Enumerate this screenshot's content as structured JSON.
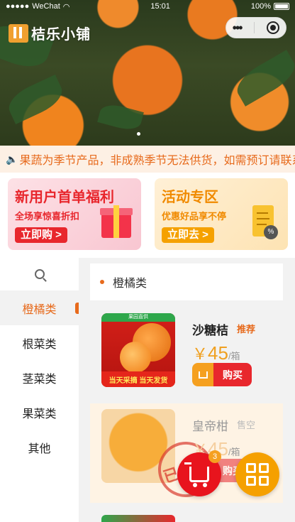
{
  "status": {
    "carrier": "WeChat",
    "signal_dots": "●●●●●",
    "time": "15:01",
    "battery": "100%"
  },
  "header": {
    "logo_text": "桔乐小铺",
    "capsule_more": "•••"
  },
  "notice": {
    "text": "果蔬为季节产品，非成熟季节无法供货，如需预订请联系"
  },
  "promos": {
    "new_user": {
      "title": "新用户首单福利",
      "subtitle": "全场享惊喜折扣",
      "button": "立即购 >"
    },
    "event": {
      "title": "活动专区",
      "subtitle": "优惠好品享不停",
      "button": "立即去 >"
    }
  },
  "sidebar": {
    "categories": [
      "橙橘类",
      "根菜类",
      "茎菜类",
      "果菜类",
      "其他"
    ],
    "active_index": 0
  },
  "content": {
    "section_title": "橙橘类",
    "products": [
      {
        "name": "沙糖桔",
        "tag": "推荐",
        "currency": "￥",
        "price": "45",
        "unit": "/箱",
        "buy_label": "购买",
        "image_strip": "当天采摘 当天发货",
        "image_badge": "果园直供"
      },
      {
        "name": "皇帝柑",
        "tag": "售空",
        "currency": "￥",
        "price": "45",
        "unit": "/箱",
        "buy_label": "购买",
        "stamp": "已售完"
      }
    ]
  },
  "floating": {
    "cart_count": "3"
  },
  "colors": {
    "accent_orange": "#e76a1c",
    "brand_red": "#e8272d",
    "price_gold": "#f0a020",
    "menu_fab": "#f5a000"
  }
}
